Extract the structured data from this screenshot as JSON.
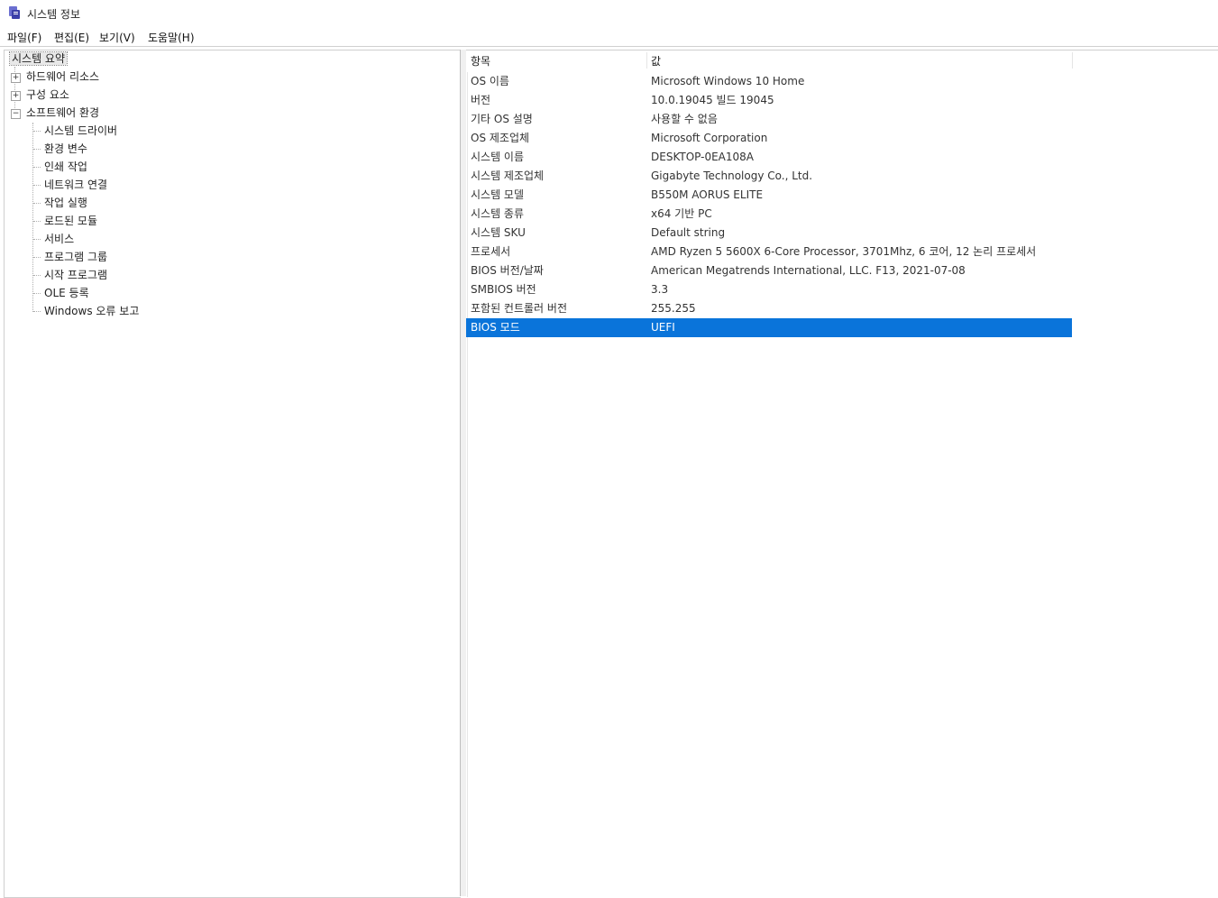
{
  "window": {
    "title": "시스템 정보",
    "icon": "system-info-icon"
  },
  "menu": [
    "파일(F)",
    "편집(E)",
    "보기(V)",
    "도움말(H)"
  ],
  "tree": {
    "root": "시스템 요약",
    "nodes": [
      {
        "label": "하드웨어 리소스",
        "expanded": false
      },
      {
        "label": "구성 요소",
        "expanded": false
      },
      {
        "label": "소프트웨어 환경",
        "expanded": true,
        "children": [
          "시스템 드라이버",
          "환경 변수",
          "인쇄 작업",
          "네트워크 연결",
          "작업 실행",
          "로드된 모듈",
          "서비스",
          "프로그램 그룹",
          "시작 프로그램",
          "OLE 등록",
          "Windows 오류 보고"
        ]
      }
    ]
  },
  "list": {
    "headers": {
      "item": "항목",
      "value": "값"
    },
    "rows": [
      {
        "item": "OS 이름",
        "value": "Microsoft Windows 10 Home"
      },
      {
        "item": "버전",
        "value": "10.0.19045 빌드 19045"
      },
      {
        "item": "기타 OS 설명",
        "value": "사용할 수 없음"
      },
      {
        "item": "OS 제조업체",
        "value": "Microsoft Corporation"
      },
      {
        "item": "시스템 이름",
        "value": "DESKTOP-0EA108A"
      },
      {
        "item": "시스템 제조업체",
        "value": "Gigabyte Technology Co., Ltd."
      },
      {
        "item": "시스템 모델",
        "value": "B550M AORUS ELITE"
      },
      {
        "item": "시스템 종류",
        "value": "x64 기반 PC"
      },
      {
        "item": "시스템 SKU",
        "value": "Default string"
      },
      {
        "item": "프로세서",
        "value": "AMD Ryzen 5 5600X 6-Core Processor, 3701Mhz, 6 코어, 12 논리 프로세서"
      },
      {
        "item": "BIOS 버전/날짜",
        "value": "American Megatrends International, LLC. F13, 2021-07-08"
      },
      {
        "item": "SMBIOS 버전",
        "value": "3.3"
      },
      {
        "item": "포함된 컨트롤러 버전",
        "value": "255.255"
      },
      {
        "item": "BIOS 모드",
        "value": "UEFI",
        "selected": true
      },
      {
        "item": "",
        "value": ""
      },
      {
        "item": "",
        "value": ""
      },
      {
        "item": "",
        "value": ""
      },
      {
        "item": "",
        "value": ""
      },
      {
        "item": "",
        "value": ""
      },
      {
        "item": "",
        "value": ""
      },
      {
        "item": "",
        "value": ""
      },
      {
        "item": "",
        "value": ""
      },
      {
        "item": "",
        "value": ""
      },
      {
        "item": "",
        "value": ""
      },
      {
        "item": "",
        "value": ""
      },
      {
        "item": "",
        "value": ""
      },
      {
        "item": "",
        "value": ""
      },
      {
        "item": "",
        "value": ""
      },
      {
        "item": "",
        "value": ""
      },
      {
        "item": "",
        "value": ""
      },
      {
        "item": "",
        "value": ""
      },
      {
        "item": "",
        "value": ""
      },
      {
        "item": "",
        "value": ""
      },
      {
        "item": "",
        "value": ""
      },
      {
        "item": "",
        "value": ""
      },
      {
        "item": "",
        "value": ""
      },
      {
        "item": "",
        "value": ""
      },
      {
        "item": "",
        "value": ""
      },
      {
        "item": "",
        "value": ""
      },
      {
        "item": "",
        "value": ""
      },
      {
        "item": "",
        "value": ""
      },
      {
        "item": "",
        "value": ""
      }
    ]
  },
  "colors": {
    "selection": "#0a74da"
  }
}
